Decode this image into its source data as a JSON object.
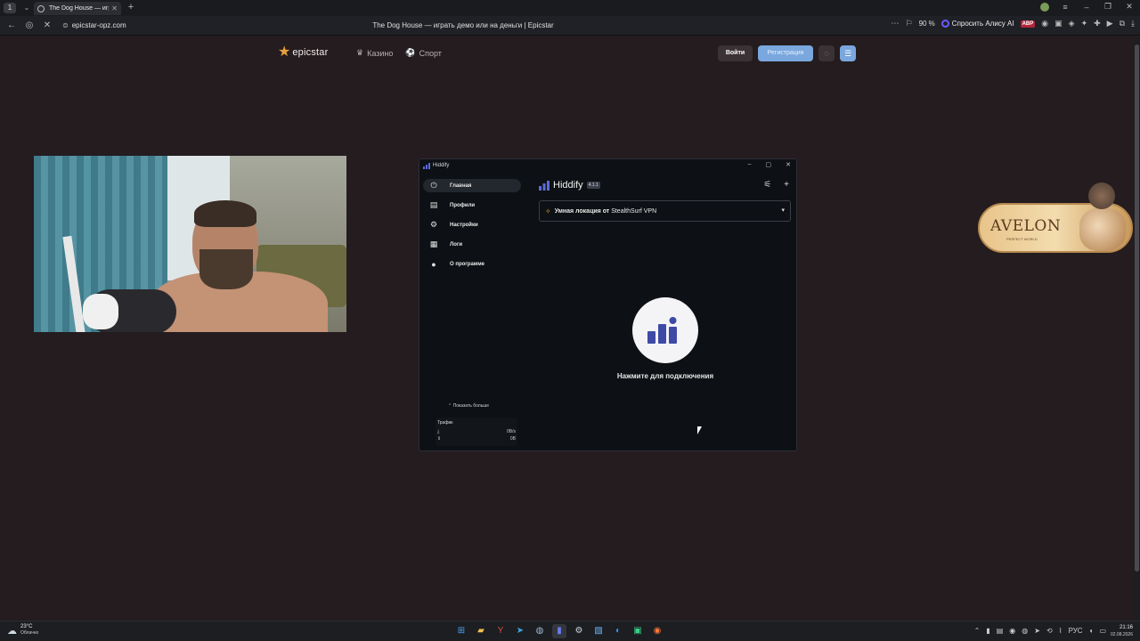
{
  "browser": {
    "tab_title": "The Dog House — играть",
    "url": "epicstar-opz.com",
    "page_title": "The Dog House — играть демо или на деньги | Epicstar",
    "zoom": "90 %",
    "alice_label": "Спросить Алису AI",
    "abp_label": "ABP"
  },
  "site": {
    "logo_text": "epicstar",
    "nav": [
      {
        "label": "Казино",
        "icon": "crown-icon"
      },
      {
        "label": "Спорт",
        "icon": "ball-icon"
      }
    ],
    "login_label": "Войти",
    "register_label": "Регистрация"
  },
  "hiddify": {
    "window_title": "Hiddify",
    "app_title": "Hiddify",
    "version": "4.1.1",
    "nav": [
      {
        "label": "Главная",
        "icon": "power-icon",
        "active": true
      },
      {
        "label": "Профили",
        "icon": "list-icon"
      },
      {
        "label": "Настройки",
        "icon": "gear-icon"
      },
      {
        "label": "Логи",
        "icon": "document-icon"
      },
      {
        "label": "О программе",
        "icon": "info-icon"
      }
    ],
    "profile_prefix": "Умная локация от",
    "profile_name": "StealthSurf VPN",
    "connect_hint": "Нажмите для подключения",
    "show_more": "Показать больше",
    "traffic_title": "Трафик",
    "traffic_speed": "0B/s",
    "traffic_total": "0B"
  },
  "ad": {
    "title": "AVELON",
    "subtitle": "PERFECT WORLD"
  },
  "taskbar": {
    "temperature": "23°C",
    "weather": "Облачно",
    "language": "РУС",
    "time": "21:16",
    "date": "02.08.2026"
  }
}
